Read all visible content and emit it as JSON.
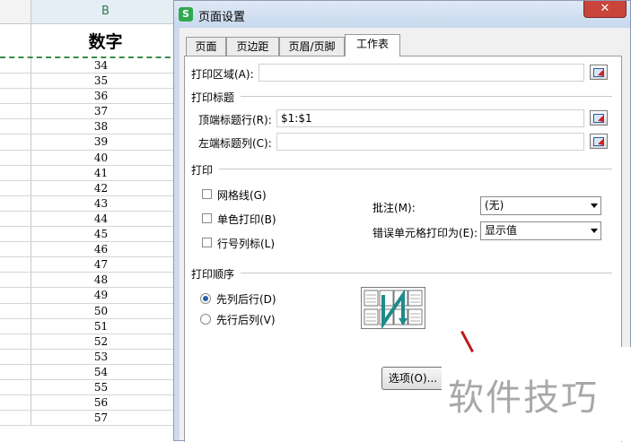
{
  "sheet": {
    "column_b": "B",
    "header": "数字",
    "rows": [
      "34",
      "35",
      "36",
      "37",
      "38",
      "39",
      "40",
      "41",
      "42",
      "43",
      "44",
      "45",
      "46",
      "47",
      "48",
      "49",
      "50",
      "51",
      "52",
      "53",
      "54",
      "55",
      "56",
      "57"
    ]
  },
  "dialog": {
    "title": "页面设置",
    "app_icon": "S",
    "close": "✕",
    "tabs": [
      "页面",
      "页边距",
      "页眉/页脚",
      "工作表"
    ],
    "print_area": {
      "label": "打印区域(A):",
      "value": ""
    },
    "print_titles": {
      "section": "打印标题",
      "top_rows": {
        "label": "顶端标题行(R):",
        "value": "$1:$1"
      },
      "left_cols": {
        "label": "左端标题列(C):",
        "value": ""
      }
    },
    "print": {
      "section": "打印",
      "gridlines": "网格线(G)",
      "mono": "单色打印(B)",
      "row_col_headers": "行号列标(L)",
      "comments": {
        "label": "批注(M):",
        "value": "(无)"
      },
      "errors": {
        "label": "错误单元格打印为(E):",
        "value": "显示值"
      }
    },
    "order": {
      "section": "打印顺序",
      "down_then_over": "先列后行(D)",
      "over_then_down": "先行后列(V)"
    },
    "options_button": "选项(O)..."
  },
  "watermark": "软件技巧",
  "colors": {
    "accent": "#2a5da8",
    "dashed_border": "#3a8c4a",
    "close": "#c9443b",
    "preview_arrow": "#1f8a8a"
  }
}
